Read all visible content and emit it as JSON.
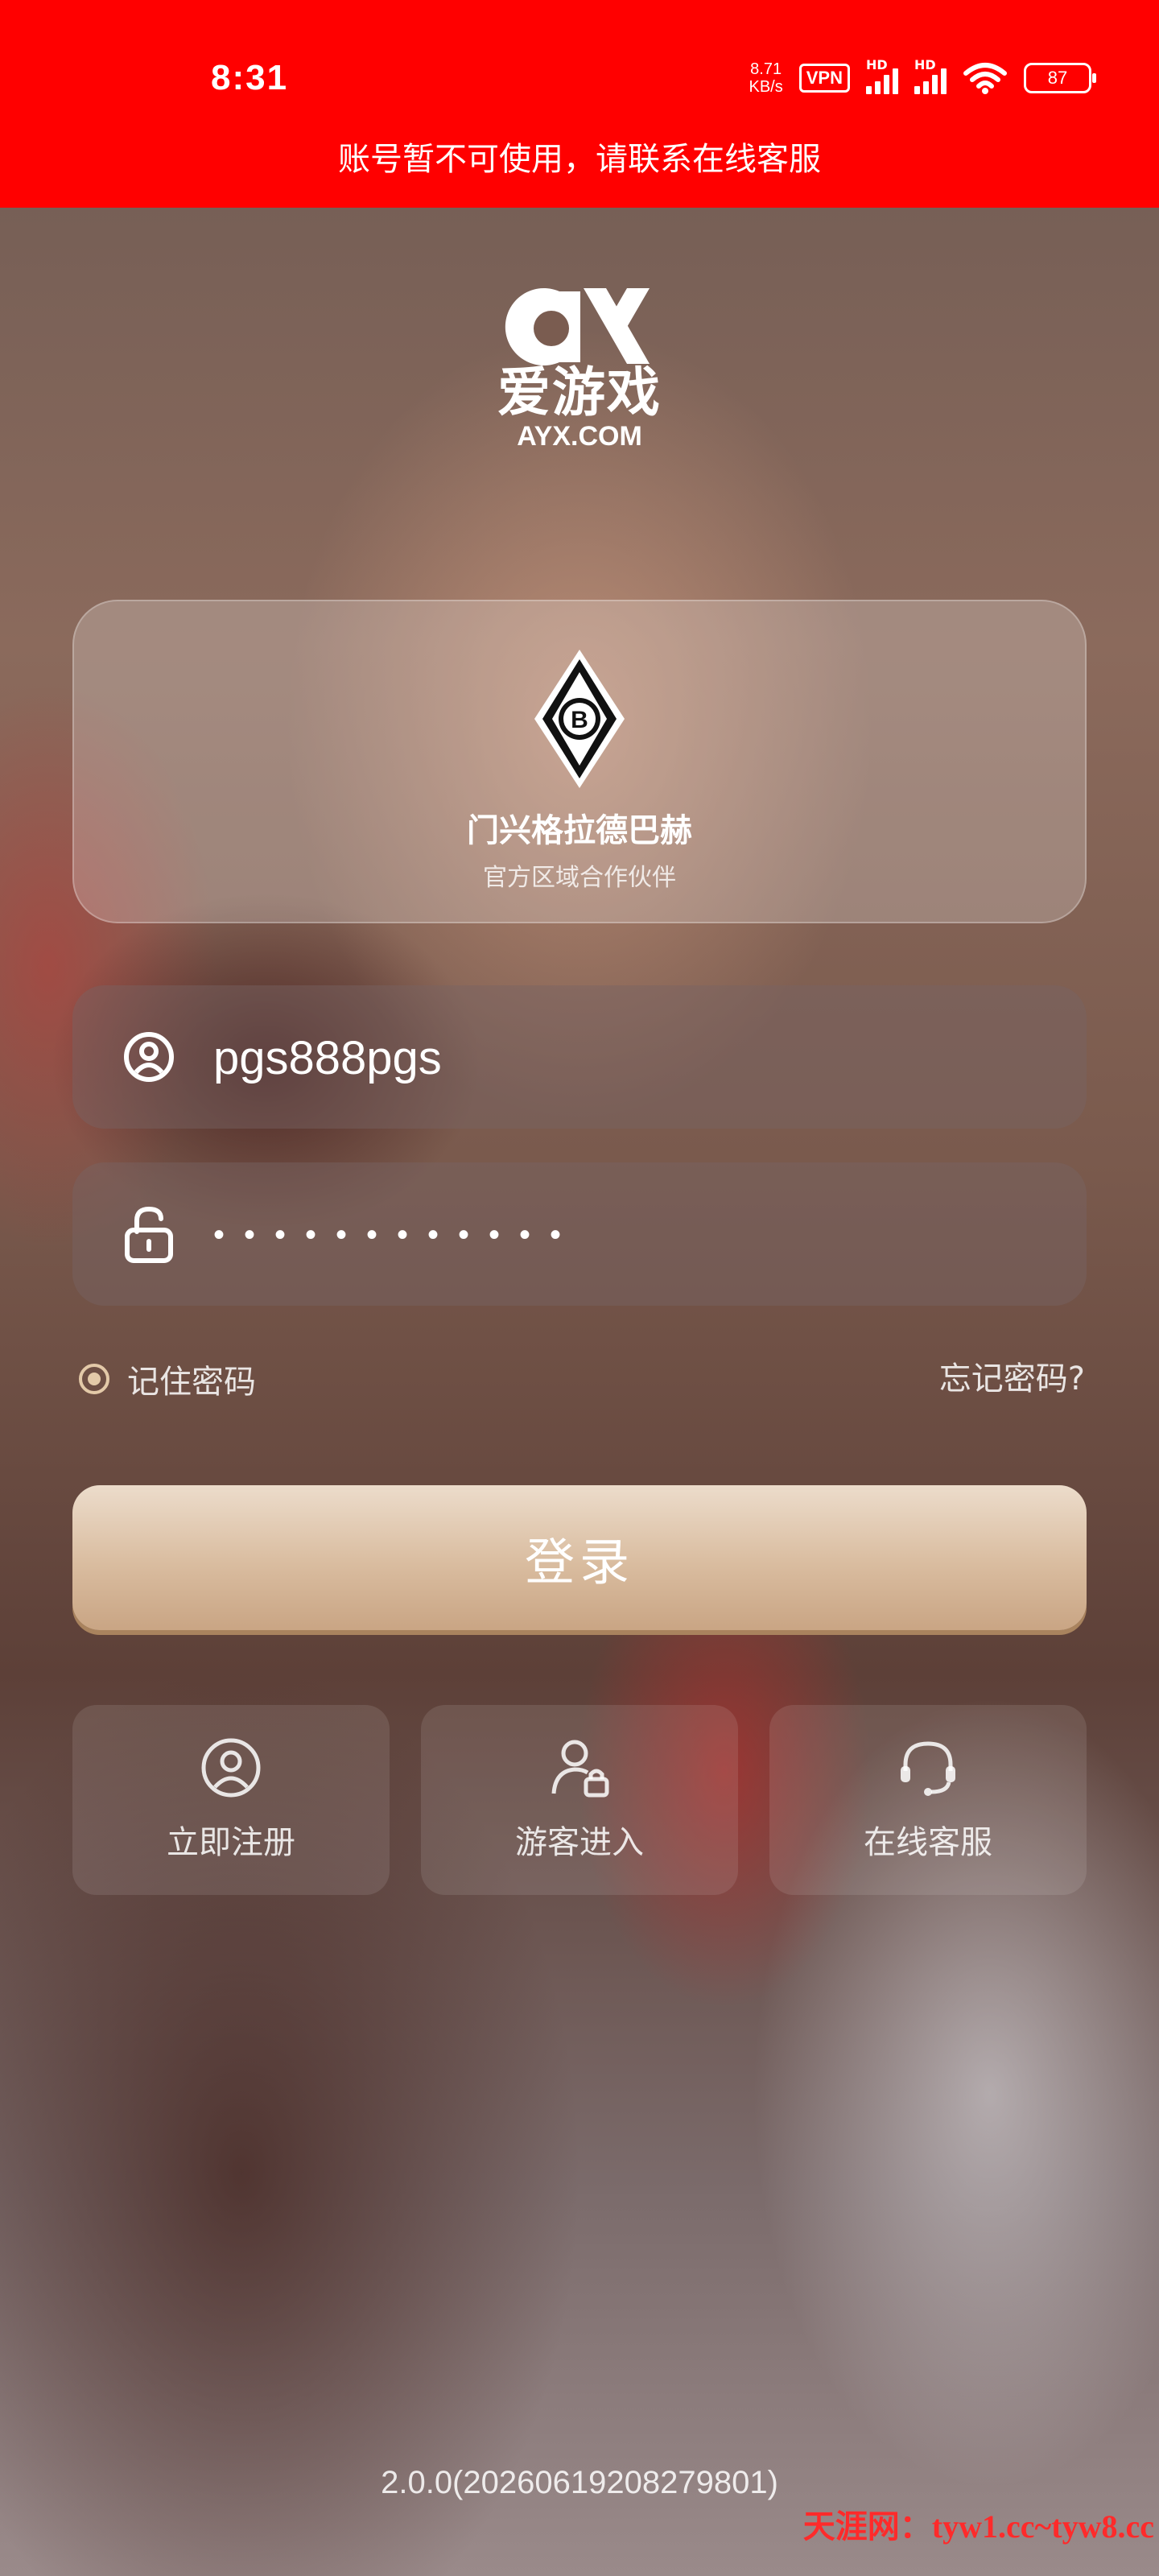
{
  "status_bar": {
    "time": "8:31",
    "net_speed_value": "8.71",
    "net_speed_unit": "KB/s",
    "vpn": "VPN",
    "hd": "HD",
    "battery": "87"
  },
  "notice": "账号暂不可使用，请联系在线客服",
  "logo": {
    "cn": "爱游戏",
    "en": "AYX.COM"
  },
  "partner": {
    "name": "门兴格拉德巴赫",
    "subtitle": "官方区域合作伙伴",
    "badge_letter": "B"
  },
  "username": {
    "value": "pgs888pgs",
    "icon": "user-circle-icon"
  },
  "password": {
    "value": "••••••••••••",
    "icon": "unlock-icon"
  },
  "remember_label": "记住密码",
  "forgot_label": "忘记密码?",
  "login_label": "登录",
  "actions": [
    {
      "label": "立即注册",
      "icon": "user-circle-icon"
    },
    {
      "label": "游客进入",
      "icon": "guest-user-icon"
    },
    {
      "label": "在线客服",
      "icon": "headset-icon"
    }
  ],
  "version": "2.0.0(20260619208279801)",
  "watermark": "天涯网：tyw1.cc~tyw8.cc",
  "colors": {
    "banner": "#ff0000",
    "accent": "#e3c9a8",
    "button": "#d9bc9f"
  }
}
